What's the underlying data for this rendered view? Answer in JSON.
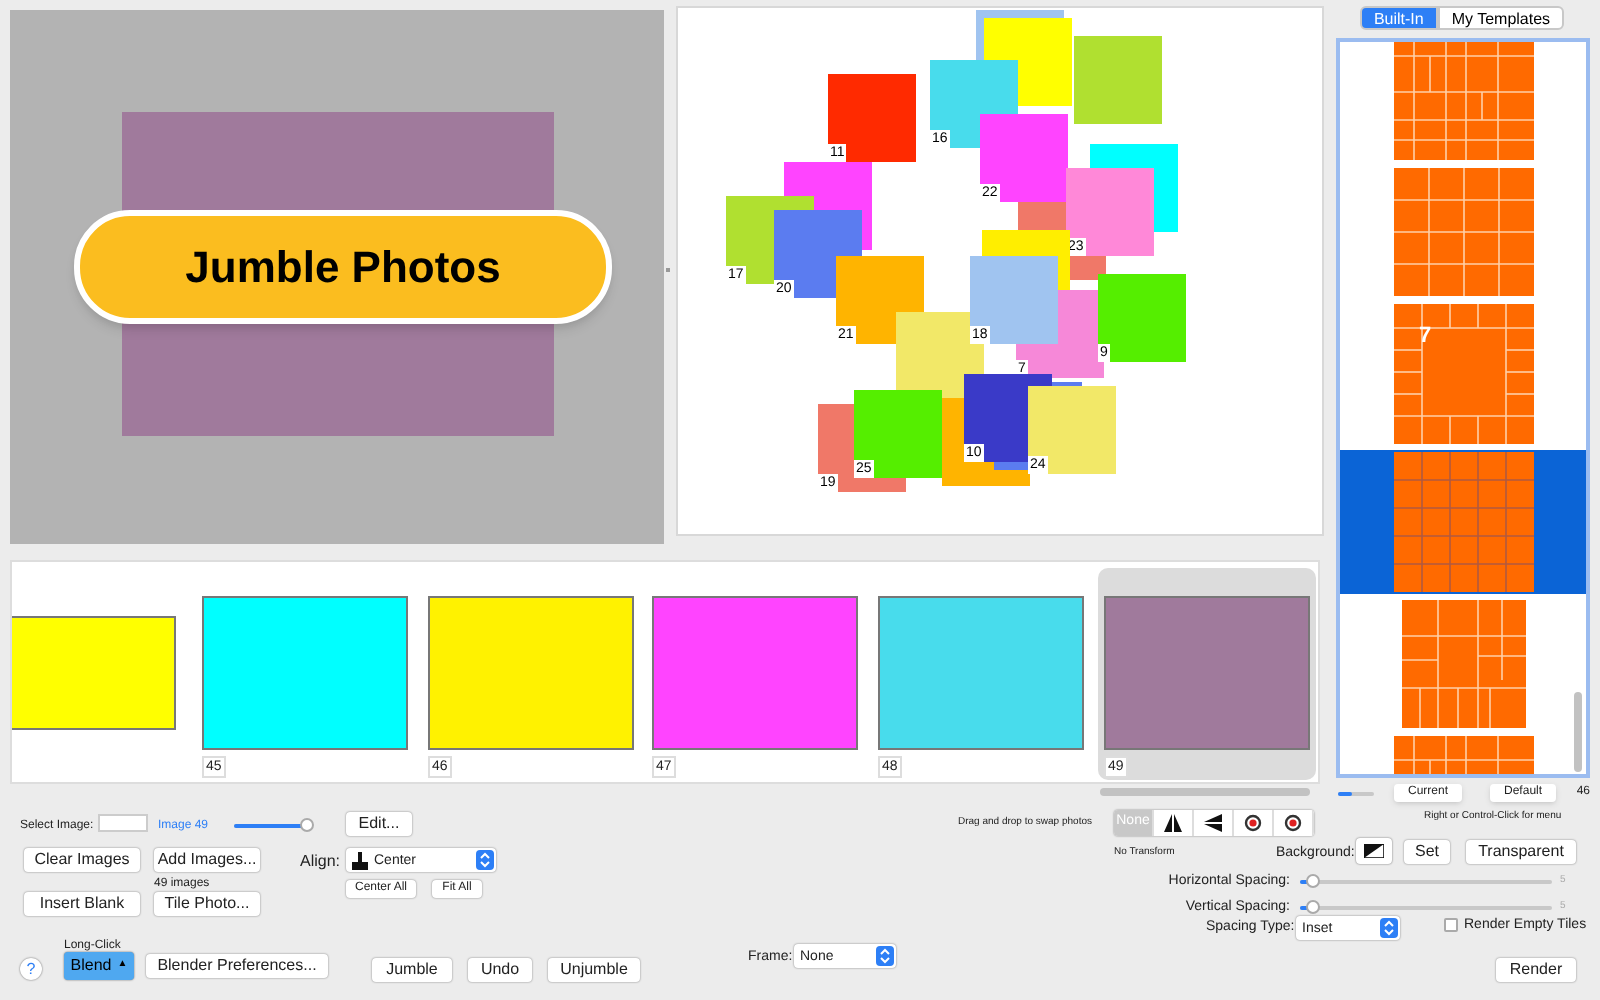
{
  "preview": {
    "banner": "Jumble Photos"
  },
  "collage": {
    "tiles": [
      {
        "color": "#a0c4f0"
      },
      {
        "color": "#b0e030"
      },
      {
        "color": "#ffff00"
      },
      {
        "color": "#48dcec",
        "label": "16"
      },
      {
        "color": "#ff2a00",
        "label": "11"
      },
      {
        "color": "#ff44ff"
      },
      {
        "color": "#b0e030",
        "label": "17"
      },
      {
        "color": "#5b7cf0",
        "label": "20"
      },
      {
        "color": "#f07868"
      },
      {
        "color": "#00ffff"
      },
      {
        "color": "#ff44ff",
        "label": "22"
      },
      {
        "color": "#ff88d8",
        "label": "23"
      },
      {
        "color": "#ffee00"
      },
      {
        "color": "#ffb400",
        "label": "21"
      },
      {
        "color": "#f2e868"
      },
      {
        "color": "#f688d8",
        "label": "7"
      },
      {
        "color": "#a0c4f0",
        "label": "18"
      },
      {
        "color": "#55ee00",
        "label": "9"
      },
      {
        "color": "#f07868",
        "label": "19"
      },
      {
        "color": "#ffb400"
      },
      {
        "color": "#5b7cf0"
      },
      {
        "color": "#3a3ac8",
        "label": "10"
      },
      {
        "color": "#55ee00",
        "label": "25"
      },
      {
        "color": "#f2e868",
        "label": "24"
      }
    ]
  },
  "templates": {
    "tabs": [
      {
        "label": "Built-In",
        "selected": true
      },
      {
        "label": "My Templates",
        "selected": false
      }
    ],
    "items": [
      {
        "kind": "mixed",
        "selected": false
      },
      {
        "kind": "grid4",
        "selected": false
      },
      {
        "kind": "feature",
        "label": "7",
        "selected": false
      },
      {
        "kind": "grid5",
        "selected": true
      },
      {
        "kind": "mosaic",
        "selected": false
      },
      {
        "kind": "mixed",
        "selected": false
      }
    ],
    "size_slider": {
      "level": 0.4
    },
    "buttons": [
      "Current",
      "Default"
    ],
    "count": "46"
  },
  "filmstrip": {
    "thumbs": [
      {
        "color": "#ffff00",
        "selected": false
      },
      {
        "color": "#00ffff",
        "label": "45",
        "selected": false
      },
      {
        "color": "#fff200",
        "label": "46",
        "selected": false
      },
      {
        "color": "#ff44ff",
        "label": "47",
        "selected": false
      },
      {
        "color": "#48dcec",
        "label": "48",
        "selected": false
      },
      {
        "color": "#a07a9c",
        "label": "49",
        "selected": true
      }
    ]
  },
  "controls": {
    "select_image": {
      "label": "Select Image:",
      "value_label": "Image 49",
      "level": 0.95
    },
    "edit": "Edit...",
    "clear": "Clear Images",
    "add": "Add Images...",
    "image_count": "49 images",
    "insert_blank": "Insert Blank",
    "tile_photo": "Tile Photo...",
    "align": {
      "label": "Align:",
      "value": "Center"
    },
    "center_all": "Center All",
    "fit_all": "Fit All",
    "long_click": "Long-Click",
    "help": "?",
    "blend": "Blend",
    "blend_arrow": "▲",
    "blender_prefs": "Blender Preferences...",
    "actions": [
      "Jumble",
      "Undo",
      "Unjumble"
    ],
    "drag_hint": "Drag and drop to swap photos",
    "transforms": [
      {
        "kind": "text",
        "label": "None",
        "selected": true
      },
      {
        "kind": "flip_h",
        "selected": false
      },
      {
        "kind": "flip_v",
        "selected": false
      },
      {
        "kind": "rot_l",
        "selected": false
      },
      {
        "kind": "rot_r",
        "selected": false
      }
    ],
    "transform_caption": "No Transform",
    "menu_hint": "Right or Control-Click for menu",
    "background": {
      "label": "Background:",
      "set": "Set",
      "transparent": "Transparent"
    },
    "h_spacing": {
      "label": "Horizontal Spacing:",
      "level": 0.05,
      "reading": "5"
    },
    "v_spacing": {
      "label": "Vertical Spacing:",
      "level": 0.05,
      "reading": "5"
    },
    "spacing_type": {
      "label": "Spacing Type:",
      "value": "Inset"
    },
    "render_empty": {
      "label": "Render Empty Tiles",
      "checked": false
    },
    "frame": {
      "label": "Frame:",
      "value": "None"
    },
    "render": "Render"
  }
}
